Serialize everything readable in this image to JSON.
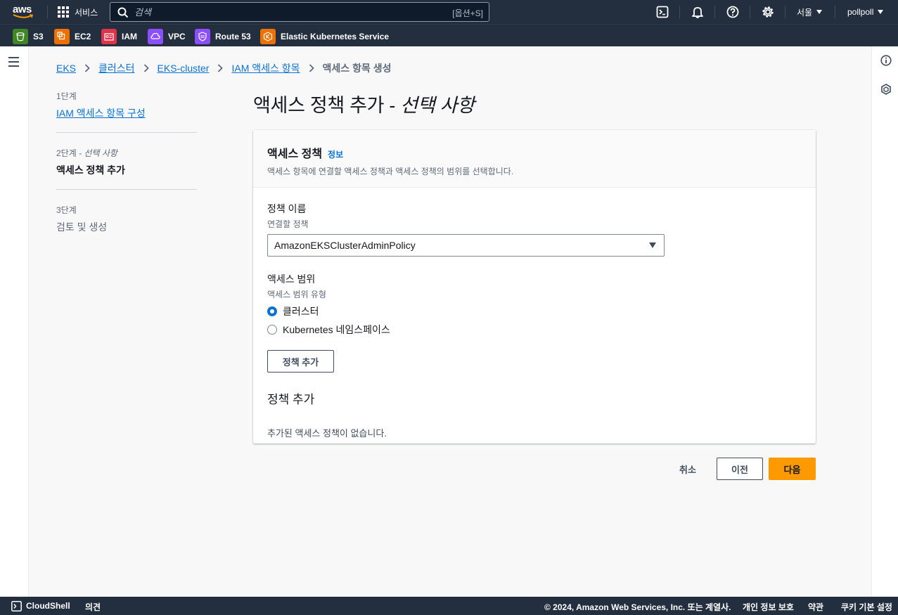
{
  "topnav": {
    "logo_text": "aws",
    "services_label": "서비스",
    "search_placeholder": "검색",
    "search_shortcut": "[옵션+S]",
    "icons": [
      "cloudshell-icon",
      "notifications-bell-icon",
      "help-icon",
      "settings-gear-icon"
    ],
    "region": "서울",
    "user": "pollpoll"
  },
  "favorites": [
    {
      "label": "S3",
      "color": "#3f8624",
      "icon": "s3-bucket-icon"
    },
    {
      "label": "EC2",
      "color": "#ed7100",
      "icon": "ec2-chip-icon"
    },
    {
      "label": "IAM",
      "color": "#dd344c",
      "icon": "iam-id-icon"
    },
    {
      "label": "VPC",
      "color": "#8c4fff",
      "icon": "vpc-cloud-icon"
    },
    {
      "label": "Route 53",
      "color": "#8c4fff",
      "icon": "route53-shield-icon"
    },
    {
      "label": "Elastic Kubernetes Service",
      "color": "#ed7100",
      "icon": "eks-hexagon-icon"
    }
  ],
  "breadcrumb": {
    "items": [
      "EKS",
      "클러스터",
      "EKS-cluster",
      "IAM 액세스 항목"
    ],
    "current": "액세스 항목 생성"
  },
  "steps": [
    {
      "num": "1단계",
      "label": "IAM 액세스 항목 구성"
    },
    {
      "num": "2단계",
      "num_suffix": " - 선택 사항",
      "label": "액세스 정책 추가"
    },
    {
      "num": "3단계",
      "label": "검토 및 생성"
    }
  ],
  "page": {
    "title": "액세스 정책 추가 - ",
    "title_italic": "선택 사항"
  },
  "card": {
    "title": "액세스 정책",
    "info_link": "정보",
    "description": "액세스 항목에 연결할 액세스 정책과 액세스 정책의 범위를 선택합니다.",
    "policy_name_label": "정책 이름",
    "policy_name_desc": "연결할 정책",
    "policy_selected": "AmazonEKSClusterAdminPolicy",
    "scope_label": "액세스 범위",
    "scope_desc": "액세스 범위 유형",
    "scope_options": [
      "클러스터",
      "Kubernetes 네임스페이스"
    ],
    "scope_selected": "클러스터",
    "add_policy_button": "정책 추가",
    "added_section_title": "정책 추가",
    "empty_message": "추가된 액세스 정책이 없습니다."
  },
  "actions": {
    "cancel": "취소",
    "previous": "이전",
    "next": "다음"
  },
  "footer": {
    "cloudshell": "CloudShell",
    "feedback": "의견",
    "copyright": "© 2024, Amazon Web Services, Inc. 또는 계열사.",
    "privacy": "개인 정보 보호",
    "terms": "약관",
    "cookies": "쿠키 기본 설정"
  },
  "colors": {
    "nav_bg": "#232f3e",
    "link": "#0972d3",
    "primary_button": "#ff9900"
  }
}
